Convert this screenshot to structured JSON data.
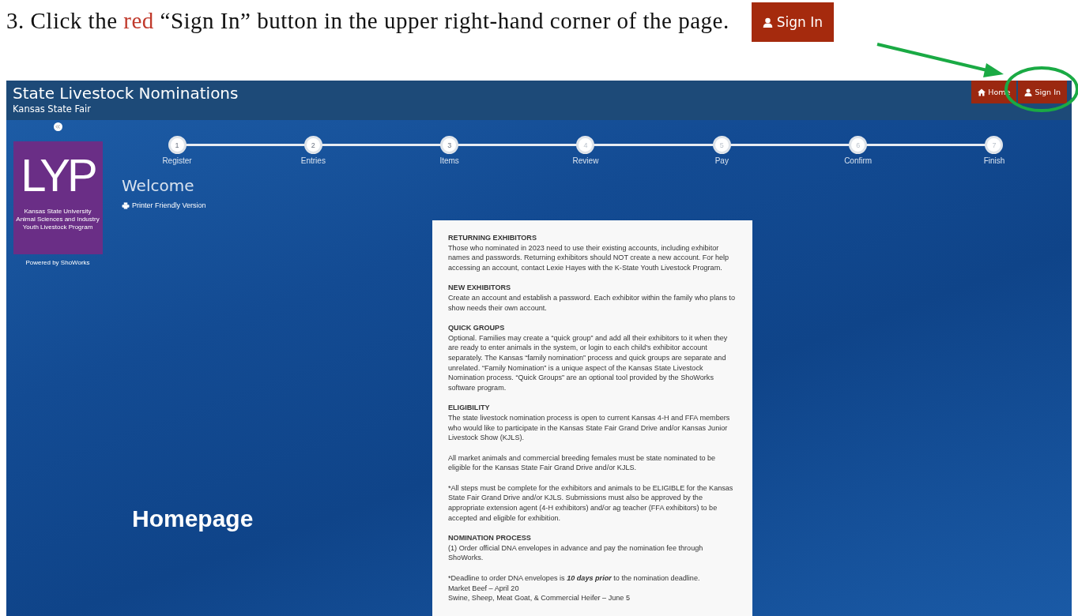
{
  "instruction": {
    "before": "3. Click the",
    "red_word": "red",
    "after": "“Sign In” button in the upper right-hand corner of the page."
  },
  "sample_button": {
    "label": "Sign In"
  },
  "app": {
    "title": "State Livestock Nominations",
    "subtitle": "Kansas State Fair",
    "nav_buttons": [
      {
        "label": "Home",
        "kind": "home"
      },
      {
        "label": "Sign In",
        "kind": "user"
      }
    ],
    "sidebar": {
      "logo_mark": "LYP",
      "logo_lines": [
        "Kansas State University",
        "Animal Sciences and Industry",
        "Youth Livestock Program"
      ],
      "powered_by": "Powered by ShoWorks"
    },
    "steps": [
      {
        "number": "1",
        "label": "Register",
        "enabled": true
      },
      {
        "number": "2",
        "label": "Entries",
        "enabled": true
      },
      {
        "number": "3",
        "label": "Items",
        "enabled": true
      },
      {
        "number": "4",
        "label": "Review",
        "enabled": false
      },
      {
        "number": "5",
        "label": "Pay",
        "enabled": false
      },
      {
        "number": "6",
        "label": "Confirm",
        "enabled": false
      },
      {
        "number": "7",
        "label": "Finish",
        "enabled": false
      }
    ],
    "page_title": "Welcome",
    "printer_link": "Printer Friendly Version",
    "document": [
      {
        "heading": "RETURNING EXHIBITORS",
        "paragraphs": [
          "Those who nominated in 2023 need to use their existing accounts, including exhibitor names and passwords. Returning exhibitors should NOT create a new account. For help accessing an account, contact Lexie Hayes with the K-State Youth Livestock Program."
        ]
      },
      {
        "heading": "NEW EXHIBITORS",
        "paragraphs": [
          "Create an account and establish a password. Each exhibitor within the family who plans to show needs their own account."
        ]
      },
      {
        "heading": "QUICK GROUPS",
        "paragraphs": [
          "Optional. Families may create a “quick group” and add all their exhibitors to it when they are ready to enter animals in the system, or login to each child’s exhibitor account separately. The Kansas “family nomination” process and quick groups are separate and unrelated. “Family Nomination” is a unique aspect of the Kansas State Livestock Nomination process. “Quick Groups” are an optional tool provided by the ShoWorks software program."
        ]
      },
      {
        "heading": "ELIGIBILITY",
        "paragraphs": [
          "The state livestock nomination process is open to current Kansas 4-H and FFA members who would like to participate in the Kansas State Fair Grand Drive and/or Kansas Junior Livestock Show (KJLS).",
          "All market animals and commercial breeding females must be state nominated to be eligible for the Kansas State Fair Grand Drive and/or KJLS.",
          "*All steps must be complete for the exhibitors and animals to be ELIGIBLE for the Kansas State Fair Grand Drive and/or KJLS. Submissions must also be approved by the appropriate extension agent (4-H exhibitors) and/or ag teacher (FFA exhibitors) to be accepted and eligible for exhibition."
        ]
      },
      {
        "heading": "NOMINATION PROCESS",
        "paragraphs": [
          "(1) Order official DNA envelopes in advance and pay the nomination fee through ShoWorks."
        ],
        "lines": [
          " *Deadline to order DNA envelopes is **10 days prior** to the nomination deadline.",
          " Market Beef – April 20",
          " Swine, Sheep, Meat Goat, & Commercial Heifer – June 5"
        ]
      }
    ]
  },
  "caption": "Homepage"
}
